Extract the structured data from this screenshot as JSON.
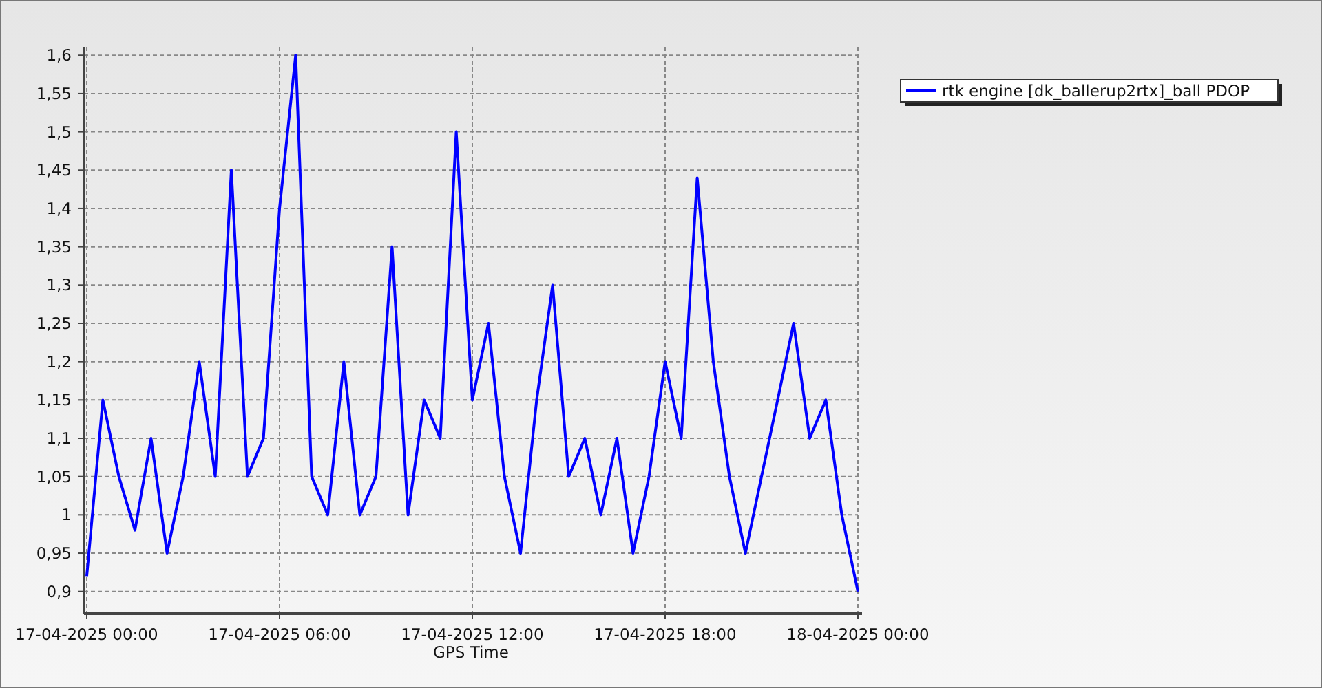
{
  "chart_data": {
    "type": "line",
    "grid": true,
    "xlabel": "GPS Time",
    "ylim": [
      0.871,
      1.611
    ],
    "categories": [
      "17-04-2025 00:00",
      null,
      null,
      null,
      null,
      null,
      null,
      null,
      null,
      null,
      null,
      null,
      "17-04-2025 06:00",
      null,
      null,
      null,
      null,
      null,
      null,
      null,
      null,
      null,
      null,
      null,
      "17-04-2025 12:00",
      null,
      null,
      null,
      null,
      null,
      null,
      null,
      null,
      null,
      null,
      null,
      "17-04-2025 18:00",
      null,
      null,
      null,
      null,
      null,
      null,
      null,
      null,
      null,
      null,
      null,
      "18-04-2025 00:00"
    ],
    "yticks": [
      {
        "value": 0.9,
        "label": "0,9"
      },
      {
        "value": 0.95,
        "label": "0,95"
      },
      {
        "value": 1,
        "label": "1"
      },
      {
        "value": 1.05,
        "label": "1,05"
      },
      {
        "value": 1.1,
        "label": "1,1"
      },
      {
        "value": 1.15,
        "label": "1,15"
      },
      {
        "value": 1.2,
        "label": "1,2"
      },
      {
        "value": 1.25,
        "label": "1,25"
      },
      {
        "value": 1.3,
        "label": "1,3"
      },
      {
        "value": 1.35,
        "label": "1,35"
      },
      {
        "value": 1.4,
        "label": "1,4"
      },
      {
        "value": 1.45,
        "label": "1,45"
      },
      {
        "value": 1.5,
        "label": "1,5"
      },
      {
        "value": 1.55,
        "label": "1,55"
      },
      {
        "value": 1.6,
        "label": "1,6"
      }
    ],
    "series": [
      {
        "name": "rtk engine [dk_ballerup2rtx]_ball PDOP",
        "color": "#0000ff",
        "values": [
          0.92,
          1.15,
          1.05,
          0.98,
          1.1,
          0.95,
          1.05,
          1.2,
          1.05,
          1.45,
          1.05,
          1.1,
          1.4,
          1.6,
          1.05,
          1.0,
          1.2,
          1.0,
          1.05,
          1.35,
          1.0,
          1.15,
          1.1,
          1.5,
          1.15,
          1.25,
          1.05,
          0.95,
          1.15,
          1.3,
          1.05,
          1.1,
          1.0,
          1.1,
          0.95,
          1.05,
          1.2,
          1.1,
          1.44,
          1.2,
          1.05,
          0.95,
          1.05,
          1.15,
          1.25,
          1.1,
          1.15,
          1.0,
          0.9
        ]
      }
    ]
  }
}
